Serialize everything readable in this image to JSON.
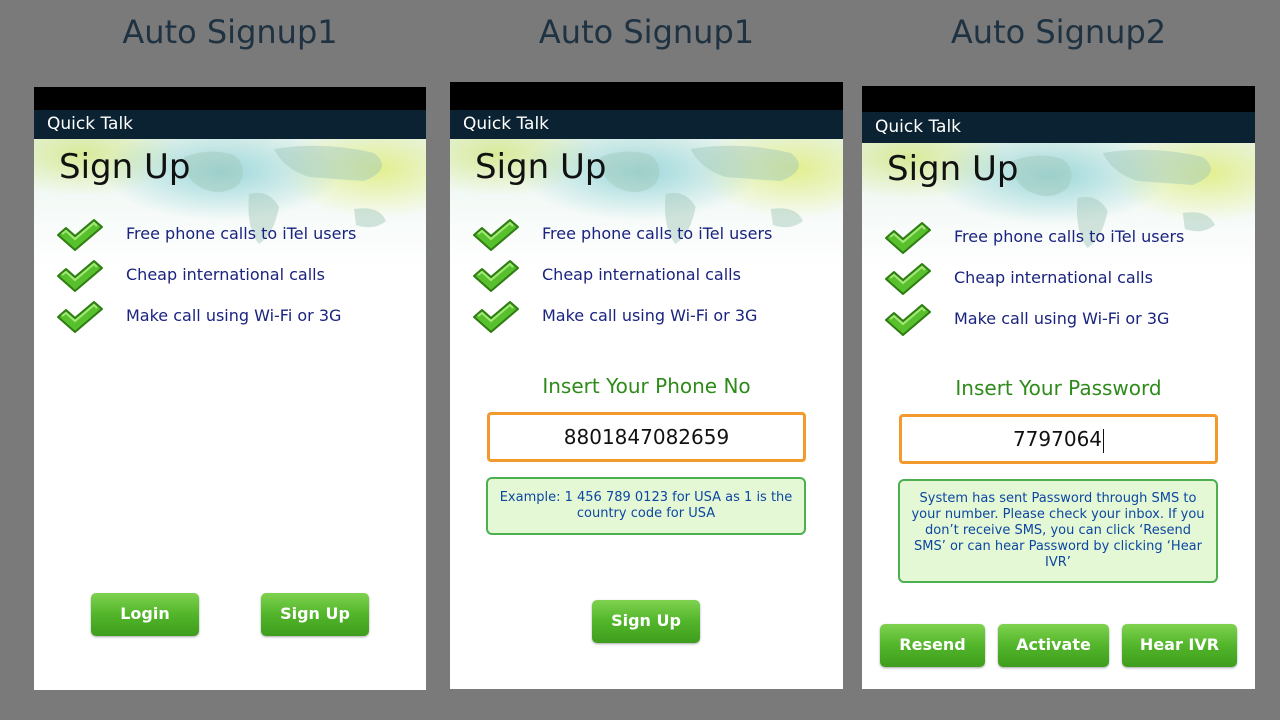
{
  "captions": [
    "Auto Signup1",
    "Auto Signup1",
    "Auto Signup2"
  ],
  "app_title": "Quick Talk",
  "signup_title": "Sign Up",
  "features": [
    "Free phone calls to iTel users",
    "Cheap international calls",
    "Make call using Wi-Fi or 3G"
  ],
  "screen1": {
    "login_button": "Login",
    "signup_button": "Sign Up"
  },
  "screen2": {
    "insert_label": "Insert Your Phone No",
    "phone_value": "8801847082659",
    "hint": "Example: 1 456 789 0123 for USA as 1 is the country code for USA",
    "signup_button": "Sign Up"
  },
  "screen3": {
    "insert_label": "Insert Your Password",
    "password_value": "7797064",
    "hint": "System has sent Password through SMS to your number. Please check your inbox. If you don’t receive SMS, you can click ‘Resend SMS’ or can hear Password by clicking ‘Hear IVR’",
    "resend_button": "Resend",
    "activate_button": "Activate",
    "hear_ivr_button": "Hear IVR"
  },
  "colors": {
    "background": "#7a7a7a",
    "titlebar": "#0b2233",
    "feature_text": "#1a237e",
    "accent_green": "#2e8b1a",
    "input_border": "#f39a2e",
    "hint_bg": "#e4f8d6"
  },
  "icons": [
    "check-icon"
  ]
}
